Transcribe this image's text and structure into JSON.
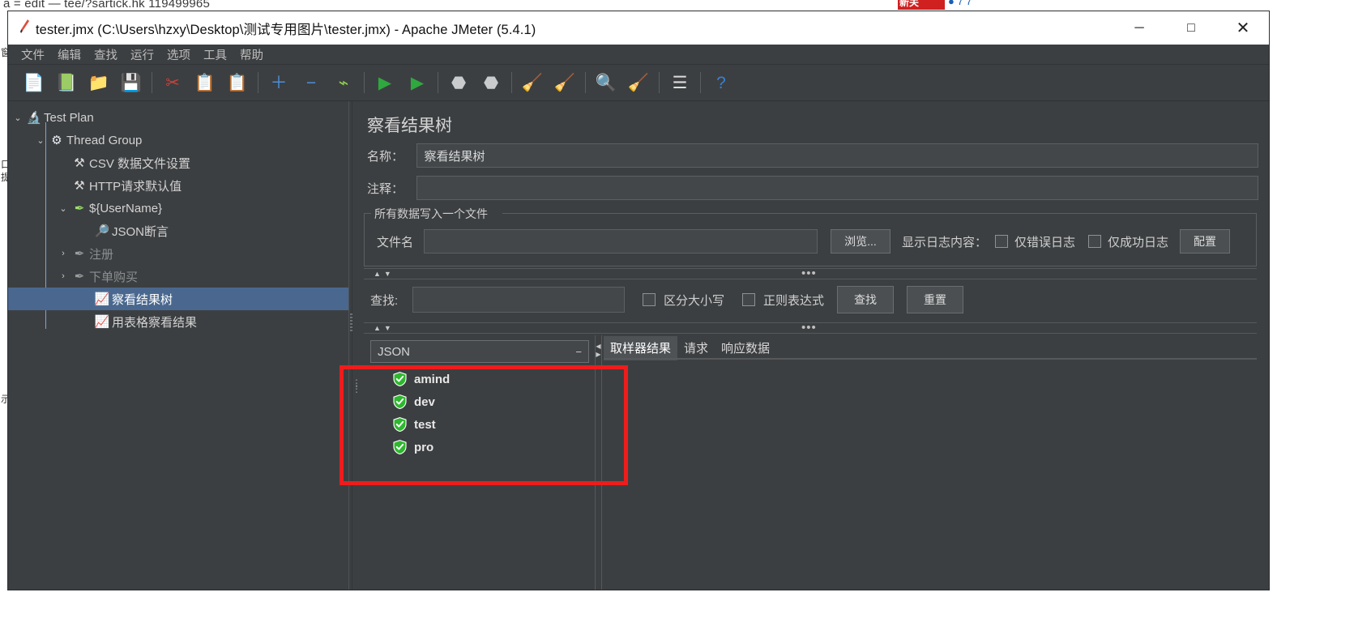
{
  "background": {
    "top_text": "a = edit — tee/?sartick.hk 119499965",
    "red_badge": "新关",
    "blue_tag": "● 7 7",
    "left_chars": [
      "窗",
      "口",
      "提",
      "示"
    ]
  },
  "window": {
    "title": "tester.jmx (C:\\Users\\hzxy\\Desktop\\测试专用图片\\tester.jmx) - Apache JMeter (5.4.1)",
    "app_icon": "jmeter-feather-icon",
    "minimize": "─",
    "maximize": "□",
    "close": "✕"
  },
  "menubar": {
    "items": [
      {
        "label": "文件",
        "name": "menu-file"
      },
      {
        "label": "编辑",
        "name": "menu-edit"
      },
      {
        "label": "查找",
        "name": "menu-search"
      },
      {
        "label": "运行",
        "name": "menu-run"
      },
      {
        "label": "选项",
        "name": "menu-options"
      },
      {
        "label": "工具",
        "name": "menu-tools"
      },
      {
        "label": "帮助",
        "name": "menu-help"
      }
    ]
  },
  "toolbar": {
    "buttons": [
      {
        "name": "new-button",
        "icon": "📄",
        "color": "#f2f2f2"
      },
      {
        "name": "templates-button",
        "icon": "📗",
        "color": "#3aa655"
      },
      {
        "name": "open-button",
        "icon": "📁",
        "color": "#e0a23c"
      },
      {
        "name": "save-button",
        "icon": "💾",
        "color": "#dcdcdc"
      },
      {
        "name": "cut-button",
        "icon": "✂",
        "color": "#d0403a"
      },
      {
        "name": "copy-button",
        "icon": "📋",
        "color": "#e8e8e8"
      },
      {
        "name": "paste-button",
        "icon": "📋",
        "color": "#dba33c"
      },
      {
        "name": "expand-all-button",
        "icon": "＋",
        "color": "#4d90d8"
      },
      {
        "name": "collapse-all-button",
        "icon": "−",
        "color": "#4d90d8"
      },
      {
        "name": "toggle-button",
        "icon": "⌁",
        "color": "#8fd04a"
      },
      {
        "name": "start-button",
        "icon": "▶",
        "color": "#2fa83f"
      },
      {
        "name": "start-no-pauses-button",
        "icon": "▶",
        "color": "#2fa83f"
      },
      {
        "name": "stop-button",
        "icon": "⬣",
        "color": "#c9cbcd"
      },
      {
        "name": "shutdown-button",
        "icon": "⬣",
        "color": "#c9cbcd"
      },
      {
        "name": "clear-button",
        "icon": "🧹",
        "color": "#cfae7a"
      },
      {
        "name": "clear-all-button",
        "icon": "🧹",
        "color": "#cfae7a"
      },
      {
        "name": "search-button",
        "icon": "🔍",
        "color": "#2b2b2b"
      },
      {
        "name": "reset-search-button",
        "icon": "🧹",
        "color": "#e3c23c"
      },
      {
        "name": "function-helper-button",
        "icon": "☰",
        "color": "#dcdcdc"
      },
      {
        "name": "help-button",
        "icon": "?",
        "color": "#3b7fd4"
      }
    ],
    "separator_after": [
      3,
      6,
      9,
      11,
      13,
      15,
      17,
      18
    ]
  },
  "tree": {
    "nodes": [
      {
        "name": "tree-node-test-plan",
        "label": "Test Plan",
        "depth": 0,
        "arrow": "⌄",
        "icon": "🔬",
        "icon_color": "#dfe6ef",
        "dim": false,
        "selected": false
      },
      {
        "name": "tree-node-thread-group",
        "label": "Thread Group",
        "depth": 1,
        "arrow": "⌄",
        "icon": "⚙",
        "icon_color": "#e9eef5",
        "dim": false,
        "selected": false
      },
      {
        "name": "tree-node-csv-data-set",
        "label": "CSV 数据文件设置",
        "depth": 2,
        "arrow": "",
        "icon": "⚒",
        "icon_color": "#d8d8d8",
        "dim": false,
        "selected": false
      },
      {
        "name": "tree-node-http-defaults",
        "label": "HTTP请求默认值",
        "depth": 2,
        "arrow": "",
        "icon": "⚒",
        "icon_color": "#d8d8d8",
        "dim": false,
        "selected": false
      },
      {
        "name": "tree-node-username",
        "label": "${UserName}",
        "depth": 2,
        "arrow": "⌄",
        "icon": "✒",
        "icon_color": "#9adf6a",
        "dim": false,
        "selected": false
      },
      {
        "name": "tree-node-json-assertion",
        "label": "JSON断言",
        "depth": 3,
        "arrow": "",
        "icon": "🔎",
        "icon_color": "#7fc2ef",
        "dim": false,
        "selected": false
      },
      {
        "name": "tree-node-register",
        "label": "注册",
        "depth": 2,
        "arrow": "›",
        "icon": "✒",
        "icon_color": "#9a9d9f",
        "dim": true,
        "selected": false
      },
      {
        "name": "tree-node-order-buy",
        "label": "下单购买",
        "depth": 2,
        "arrow": "›",
        "icon": "✒",
        "icon_color": "#9a9d9f",
        "dim": true,
        "selected": false
      },
      {
        "name": "tree-node-view-results-tree",
        "label": "察看结果树",
        "depth": 3,
        "arrow": "",
        "icon": "📈",
        "icon_color": "#f2a0bc",
        "dim": false,
        "selected": true
      },
      {
        "name": "tree-node-view-results-table",
        "label": "用表格察看结果",
        "depth": 3,
        "arrow": "",
        "icon": "📈",
        "icon_color": "#f2a0bc",
        "dim": false,
        "selected": false
      }
    ]
  },
  "panel": {
    "title": "察看结果树",
    "name_label": "名称：",
    "name_value": "察看结果树",
    "comment_label": "注释：",
    "comment_value": "",
    "filegroup_title": "所有数据写入一个文件",
    "filename_label": "文件名",
    "filename_value": "",
    "browse_button": "浏览...",
    "log_display_label": "显示日志内容：",
    "errors_only_label": "仅错误日志",
    "successes_only_label": "仅成功日志",
    "configure_button": "配置",
    "errors_only_checked": false,
    "successes_only_checked": false
  },
  "search": {
    "label": "查找:",
    "value": "",
    "case_sensitive_label": "区分大小写",
    "case_sensitive_checked": false,
    "regex_label": "正则表达式",
    "regex_checked": false,
    "find_button": "查找",
    "reset_button": "重置"
  },
  "results": {
    "renderer_selected": "JSON",
    "renderer_caret": "−",
    "items": [
      {
        "name": "result-item-amind",
        "label": "amind",
        "status": "success"
      },
      {
        "name": "result-item-dev",
        "label": "dev",
        "status": "success"
      },
      {
        "name": "result-item-test",
        "label": "test",
        "status": "success"
      },
      {
        "name": "result-item-pro",
        "label": "pro",
        "status": "success"
      }
    ],
    "tabs": [
      {
        "name": "tab-sampler-result",
        "label": "取样器结果",
        "active": true
      },
      {
        "name": "tab-request",
        "label": "请求",
        "active": false
      },
      {
        "name": "tab-response-data",
        "label": "响应数据",
        "active": false
      }
    ]
  },
  "annotation": {
    "box_color": "#ee1c1c"
  },
  "dividers": {
    "up_arrow": "▲",
    "down_arrow": "▼",
    "dots": "•••"
  }
}
